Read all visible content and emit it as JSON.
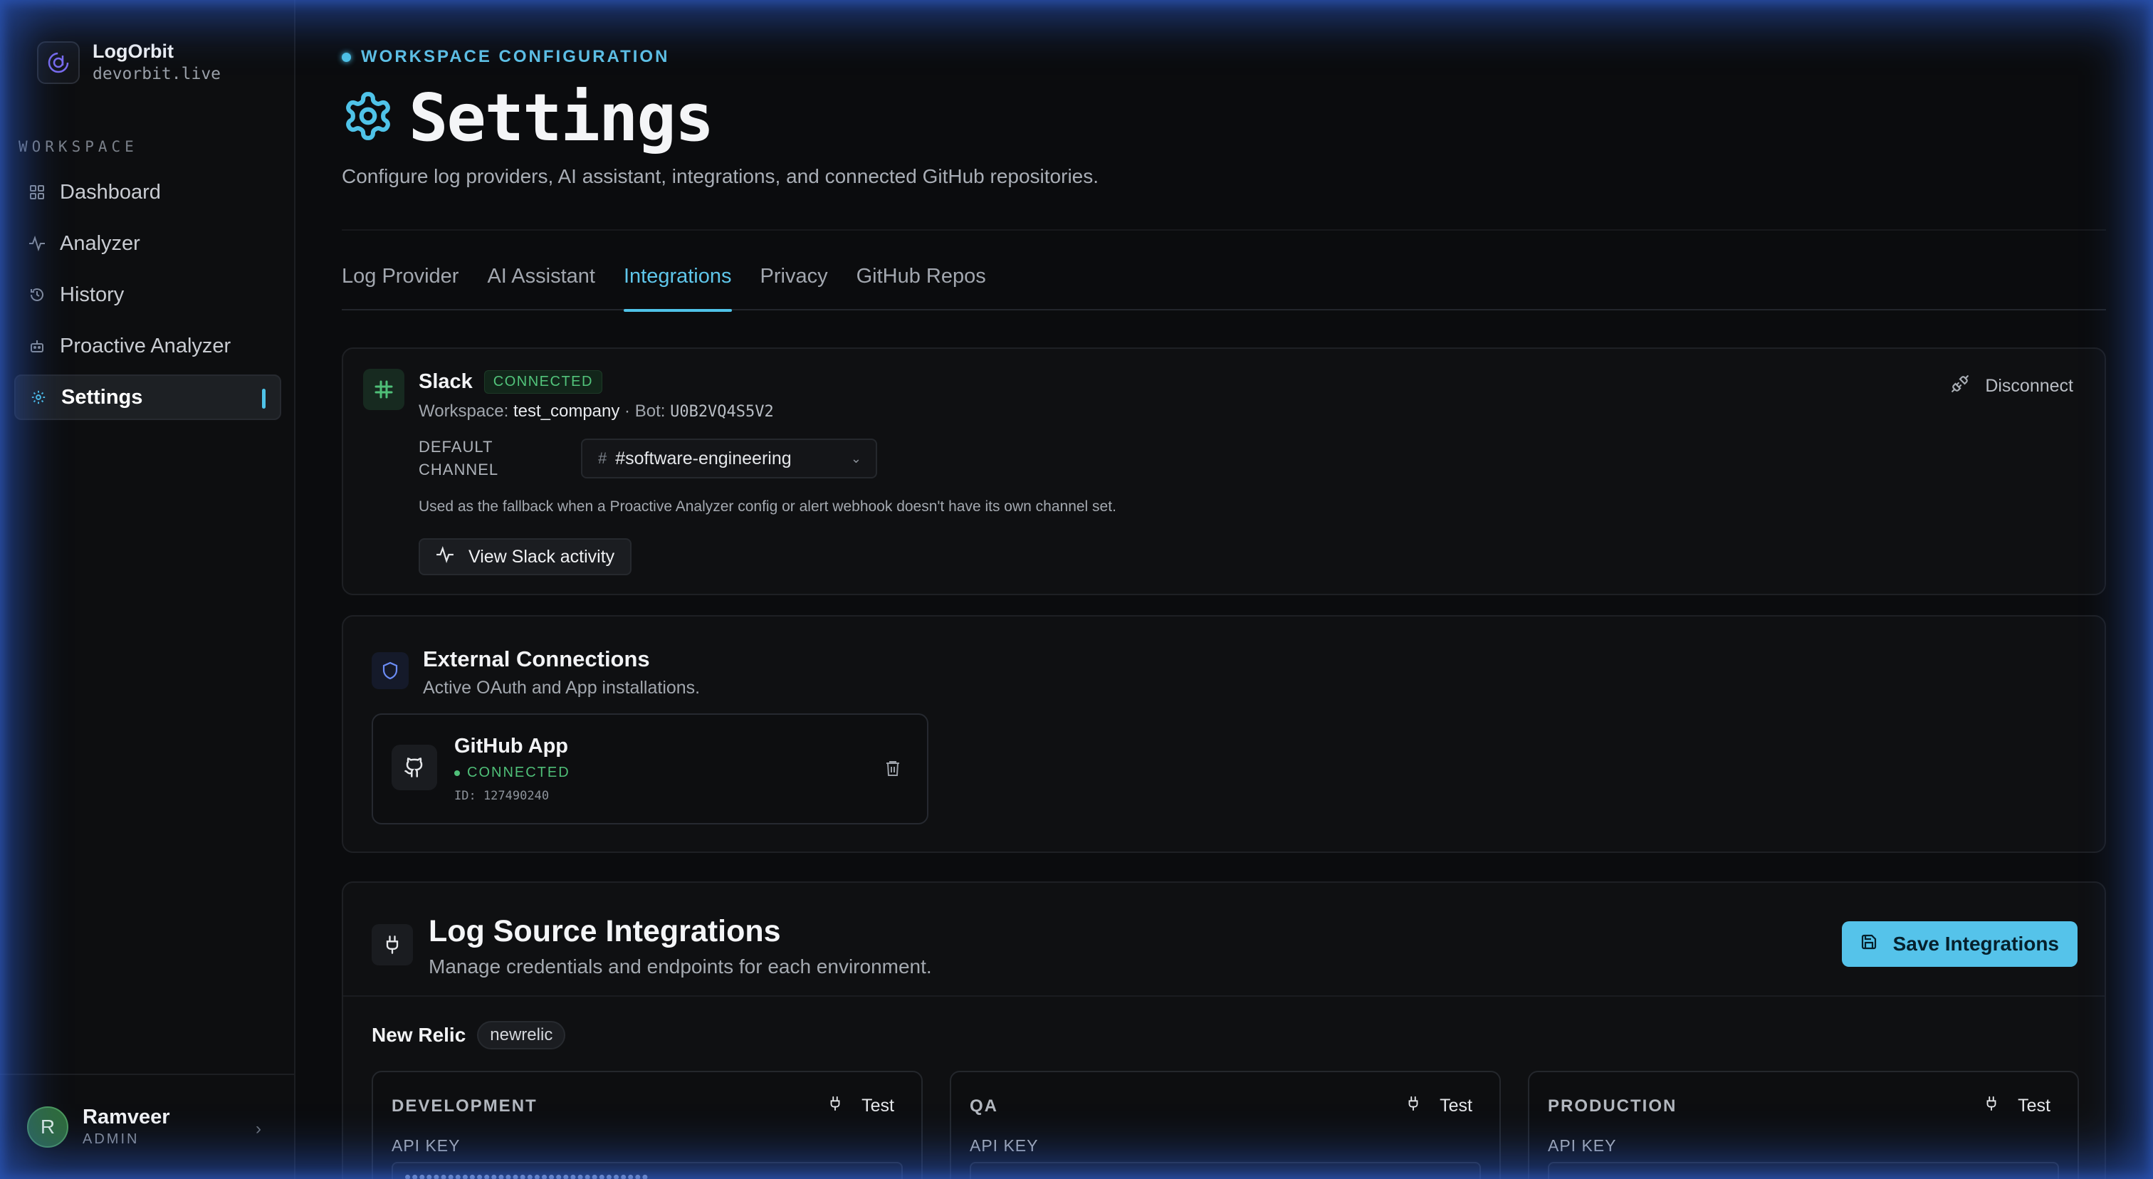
{
  "sidebar": {
    "brand_name": "LogOrbit",
    "brand_domain": "devorbit.live",
    "section_heading": "WORKSPACE",
    "items": [
      {
        "label": "Dashboard",
        "icon": "grid-icon"
      },
      {
        "label": "Analyzer",
        "icon": "activity-icon"
      },
      {
        "label": "History",
        "icon": "history-icon"
      },
      {
        "label": "Proactive Analyzer",
        "icon": "bot-icon"
      },
      {
        "label": "Settings",
        "icon": "gear-icon",
        "active": true
      }
    ],
    "user": {
      "initial": "R",
      "name": "Ramveer",
      "role": "ADMIN"
    }
  },
  "header": {
    "eyebrow": "WORKSPACE CONFIGURATION",
    "title": "Settings",
    "subtitle": "Configure log providers, AI assistant, integrations, and connected GitHub repositories."
  },
  "tabs": [
    {
      "label": "Log Provider"
    },
    {
      "label": "AI Assistant"
    },
    {
      "label": "Integrations",
      "active": true
    },
    {
      "label": "Privacy"
    },
    {
      "label": "GitHub Repos"
    }
  ],
  "slack": {
    "name": "Slack",
    "status": "CONNECTED",
    "workspace_label": "Workspace:",
    "workspace_value": "test_company",
    "bot_label": "· Bot:",
    "bot_value": "U0B2VQ4S5V2",
    "disconnect_label": "Disconnect",
    "default_channel_label_1": "DEFAULT",
    "default_channel_label_2": "CHANNEL",
    "channel_value": "#software-engineering",
    "help_text": "Used as the fallback when a Proactive Analyzer config or alert webhook doesn't have its own channel set.",
    "activity_button": "View Slack activity"
  },
  "external": {
    "title": "External Connections",
    "subtitle": "Active OAuth and App installations.",
    "github_app": {
      "name": "GitHub App",
      "status": "CONNECTED",
      "id_text": "ID: 127490240"
    }
  },
  "log_sources": {
    "title": "Log Source Integrations",
    "subtitle": "Manage credentials and endpoints for each environment.",
    "save_button": "Save Integrations",
    "provider_name": "New Relic",
    "provider_tag": "newrelic",
    "environments": [
      {
        "name": "DEVELOPMENT",
        "test_label": "Test",
        "api_key_label": "API KEY",
        "api_key_masked": "••••••••••••••••••••••••••••••••••"
      },
      {
        "name": "QA",
        "test_label": "Test",
        "api_key_label": "API KEY",
        "api_key_masked": ""
      },
      {
        "name": "PRODUCTION",
        "test_label": "Test",
        "api_key_label": "API KEY",
        "api_key_masked": ""
      }
    ]
  },
  "colors": {
    "accent": "#4fc3e8",
    "connected_green": "#52c47b",
    "background": "#0b0c0e"
  }
}
